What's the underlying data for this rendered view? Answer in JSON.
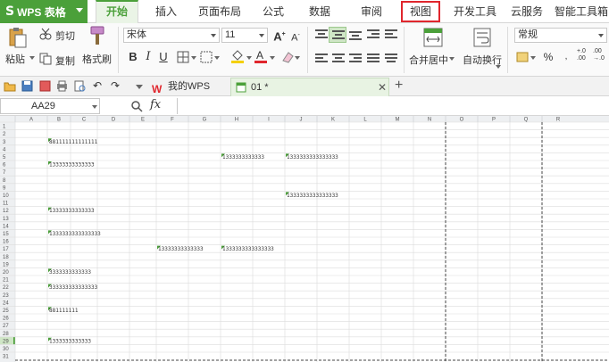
{
  "app": {
    "name": "WPS 表格"
  },
  "menu": {
    "tabs": [
      "开始",
      "插入",
      "页面布局",
      "公式",
      "数据",
      "审阅",
      "视图",
      "开发工具",
      "云服务",
      "智能工具箱"
    ],
    "active": "开始",
    "highlighted": "视图"
  },
  "ribbon": {
    "paste": "粘贴",
    "cut": "剪切",
    "copy": "复制",
    "format_painter": "格式刷",
    "font_name": "宋体",
    "font_size": "11",
    "merge_center": "合并居中",
    "wrap_text": "自动换行",
    "number_format": "常规"
  },
  "doc_tabs": [
    {
      "label": "我的WPS"
    },
    {
      "label": "01 *"
    }
  ],
  "formula_bar": {
    "name_box": "AA29",
    "fx": "fx",
    "value": ""
  },
  "sheet": {
    "columns": [
      "A",
      "B",
      "C",
      "D",
      "E",
      "F",
      "G",
      "H",
      "I",
      "J",
      "K",
      "L",
      "M",
      "N",
      "O",
      "P",
      "Q",
      "R"
    ],
    "rows": [
      "1",
      "2",
      "3",
      "4",
      "5",
      "6",
      "7",
      "8",
      "9",
      "10",
      "11",
      "12",
      "13",
      "14",
      "15",
      "16",
      "17",
      "18",
      "19",
      "20",
      "21",
      "22",
      "23",
      "24",
      "25",
      "26",
      "27",
      "28",
      "29",
      "30",
      "31"
    ],
    "active_row": "29",
    "cells": [
      {
        "row": 3,
        "col": "B",
        "text": "881111111111111"
      },
      {
        "row": 5,
        "col": "H",
        "text": "1333333333333"
      },
      {
        "row": 5,
        "col": "J",
        "text": "1333333333333333"
      },
      {
        "row": 6,
        "col": "B",
        "text": "13333333333333"
      },
      {
        "row": 10,
        "col": "J",
        "text": "1333333333333333"
      },
      {
        "row": 12,
        "col": "B",
        "text": "13333333333333"
      },
      {
        "row": 15,
        "col": "B",
        "text": "1333333333333333"
      },
      {
        "row": 17,
        "col": "F",
        "text": "13333333333333"
      },
      {
        "row": 17,
        "col": "H",
        "text": "1333333333333333"
      },
      {
        "row": 20,
        "col": "B",
        "text": "3333333333333"
      },
      {
        "row": 22,
        "col": "B",
        "text": "333333333333333"
      },
      {
        "row": 25,
        "col": "B",
        "text": "881111111"
      },
      {
        "row": 29,
        "col": "B",
        "text": "1333333333333"
      }
    ]
  },
  "colors": {
    "accent": "#4ba03a",
    "highlight": "#e0262d"
  }
}
